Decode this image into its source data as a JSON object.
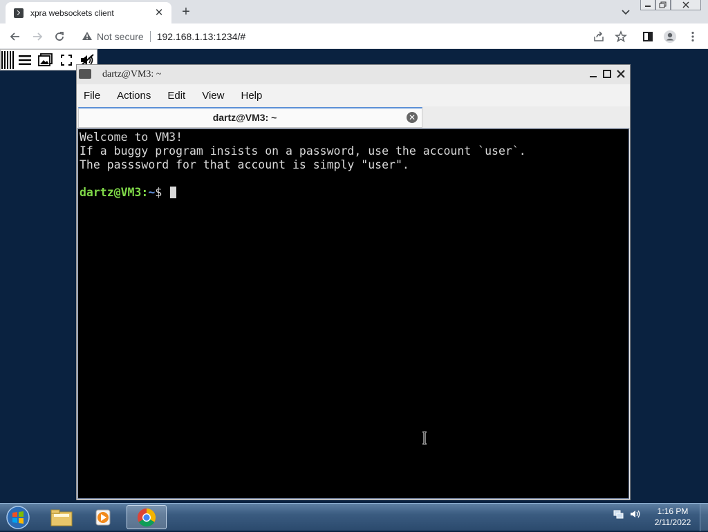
{
  "browser": {
    "tab_title": "xpra websockets client",
    "not_secure_label": "Not secure",
    "url": "192.168.1.13:1234/#"
  },
  "terminal": {
    "window_title": "dartz@VM3: ~",
    "menu": [
      "File",
      "Actions",
      "Edit",
      "View",
      "Help"
    ],
    "tab_label": "dartz@VM3: ~",
    "output_lines": [
      "Welcome to VM3!",
      "If a buggy program insists on a password, use the account `user`.",
      "The passsword for that account is simply \"user\".",
      ""
    ],
    "prompt_user": "dartz@VM3",
    "prompt_sep": ":",
    "prompt_path": "~",
    "prompt_symbol": "$ "
  },
  "taskbar": {
    "time": "1:16 PM",
    "date": "2/11/2022"
  },
  "colors": {
    "desktop": "#0a2240",
    "prompt_user": "#7fd848",
    "prompt_path": "#5e8dd6"
  }
}
